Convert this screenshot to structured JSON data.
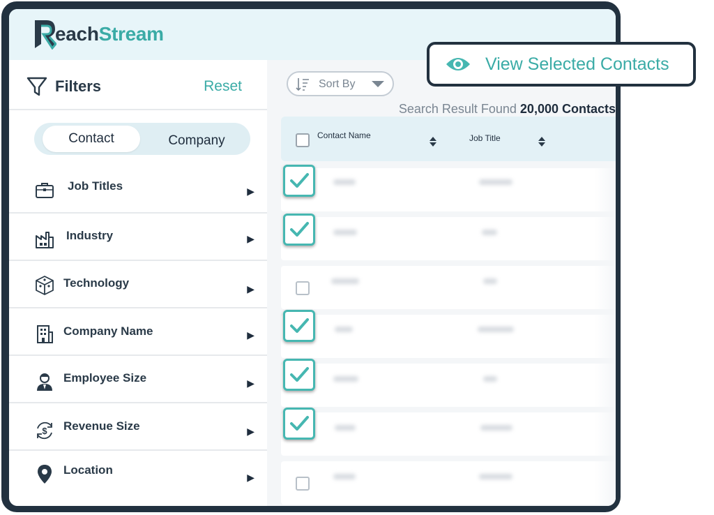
{
  "app": {
    "logo_r": "R",
    "logo_each": "each",
    "logo_stream": "Stream"
  },
  "filters": {
    "title": "Filters",
    "reset": "Reset",
    "tabs": {
      "contact": "Contact",
      "company": "Company"
    },
    "items": [
      {
        "label": "Job Titles",
        "icon": "briefcase-icon"
      },
      {
        "label": "Industry",
        "icon": "factory-icon"
      },
      {
        "label": "Technology",
        "icon": "technology-cube-icon"
      },
      {
        "label": "Company Name",
        "icon": "building-icon"
      },
      {
        "label": "Employee Size",
        "icon": "employee-icon"
      },
      {
        "label": "Revenue Size",
        "icon": "revenue-dollar-icon"
      },
      {
        "label": "Location",
        "icon": "location-pin-icon"
      }
    ]
  },
  "results": {
    "sort_label": "Sort By",
    "found_prefix": "Search Result Found",
    "found_count": "20,000 Contacts",
    "columns": [
      "Contact Name",
      "Job Title"
    ],
    "rows_checked": [
      true,
      true,
      false,
      true,
      true,
      true,
      false
    ]
  },
  "view_selected": {
    "label": "View Selected Contacts"
  },
  "colors": {
    "accent": "#3aaba6",
    "dark": "#22313f",
    "header_bg": "#e7f5f9"
  }
}
